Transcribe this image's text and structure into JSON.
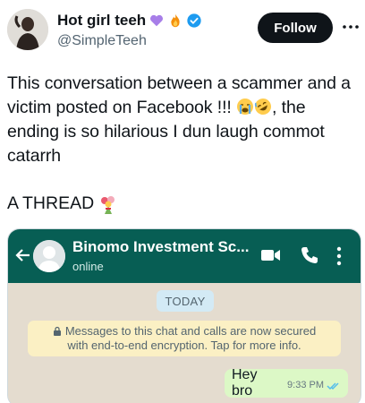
{
  "author": {
    "display_name": "Hot girl teeh",
    "handle": "@SimpleTeeh",
    "name_emojis": [
      "purple-heart-icon",
      "fire-icon"
    ],
    "verified": true
  },
  "actions": {
    "follow_label": "Follow",
    "more_icon": "more-dots-icon"
  },
  "tweet": {
    "line1": "This conversation between a scammer and a",
    "line2_a": "victim posted on Facebook !!! ",
    "line2_b": ", the",
    "line3": "ending is so hilarious I dun laugh commot",
    "line4": "catarrh",
    "thread_label": "A THREAD",
    "emojis": [
      "crying-face-icon",
      "rofl-face-icon",
      "bouquet-icon"
    ]
  },
  "media": {
    "contact_name": "Binomo Investment Sc...",
    "contact_status": "online",
    "date_label": "TODAY",
    "encryption_line1": "Messages to this chat and calls are now secured",
    "encryption_line2": "with end-to-end encryption. Tap for more info.",
    "messages": [
      {
        "text": "Hey bro",
        "time": "9:33 PM",
        "outgoing": true,
        "status": "read"
      }
    ]
  },
  "colors": {
    "follow_bg": "#0f1419",
    "whatsapp_bar": "#075e54",
    "outgoing_bubble": "#dcf8c6",
    "verified_blue": "#1d9bf0"
  }
}
